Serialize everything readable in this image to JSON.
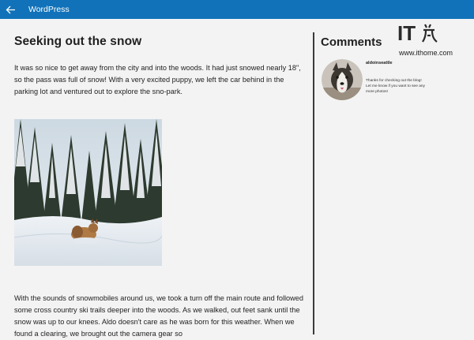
{
  "app": {
    "title": "WordPress",
    "back_icon": "back-arrow-icon",
    "titlebar_color": "#1172b9"
  },
  "post": {
    "title": "Seeking out the snow",
    "paragraphs": [
      "It was so nice to get away from the city and into the woods.  It had just snowed nearly 18\", so the pass was full of snow!  With a very excited puppy, we left the car behind in the parking lot and ventured out to explore the sno-park.",
      "With the sounds of snowmobiles around us, we took a turn off the main route and followed some cross country ski trails deeper into the woods.  As we walked, out feet sank until the snow was up to our knees.  Aldo doesn't care as he was born for this weather.  When we found a clearing, we brought out the camera gear so"
    ]
  },
  "comments": {
    "heading": "Comments",
    "items": [
      {
        "author": "aldoinseattle",
        "lines": [
          "Thanks for checking out the blog!",
          "Let me know if you want to see any",
          "more photos!"
        ]
      }
    ]
  },
  "watermark": {
    "logo_text": "IT之家",
    "url": "www.ithome.com"
  }
}
